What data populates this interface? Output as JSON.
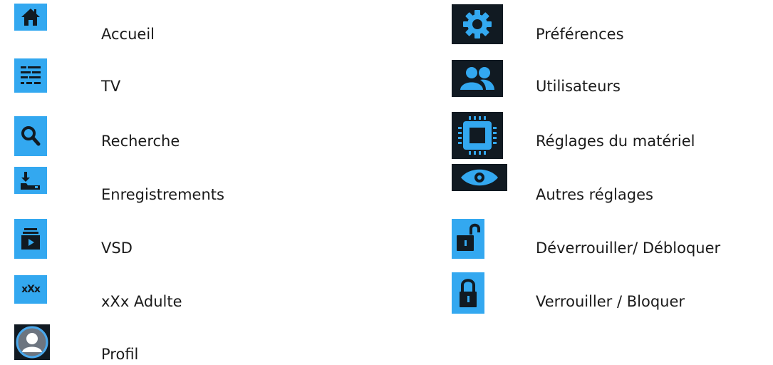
{
  "left_column": [
    {
      "label": "Accueil",
      "icon": "home-icon"
    },
    {
      "label": "TV",
      "icon": "tv-guide-icon"
    },
    {
      "label": "Recherche",
      "icon": "search-icon"
    },
    {
      "label": "Enregistrements",
      "icon": "recordings-icon"
    },
    {
      "label": "VSD",
      "icon": "vod-icon"
    },
    {
      "label": "xXx Adulte",
      "icon": "adult-icon",
      "icon_text": "xXx"
    },
    {
      "label": "Profil",
      "icon": "profile-icon"
    }
  ],
  "right_column": [
    {
      "label": "Préférences",
      "icon": "gear-icon"
    },
    {
      "label": "Utilisateurs",
      "icon": "users-icon"
    },
    {
      "label": "Réglages du matériel",
      "icon": "hardware-chip-icon"
    },
    {
      "label": "Autres réglages",
      "icon": "eye-icon"
    },
    {
      "label": "Déverrouiller/ Débloquer",
      "icon": "unlock-icon"
    },
    {
      "label": "Verrouiller / Bloquer",
      "icon": "lock-icon"
    }
  ],
  "colors": {
    "icon_blue": "#33a8f0",
    "icon_dark": "#111a22",
    "text": "#1b1b1b",
    "background": "#ffffff"
  }
}
